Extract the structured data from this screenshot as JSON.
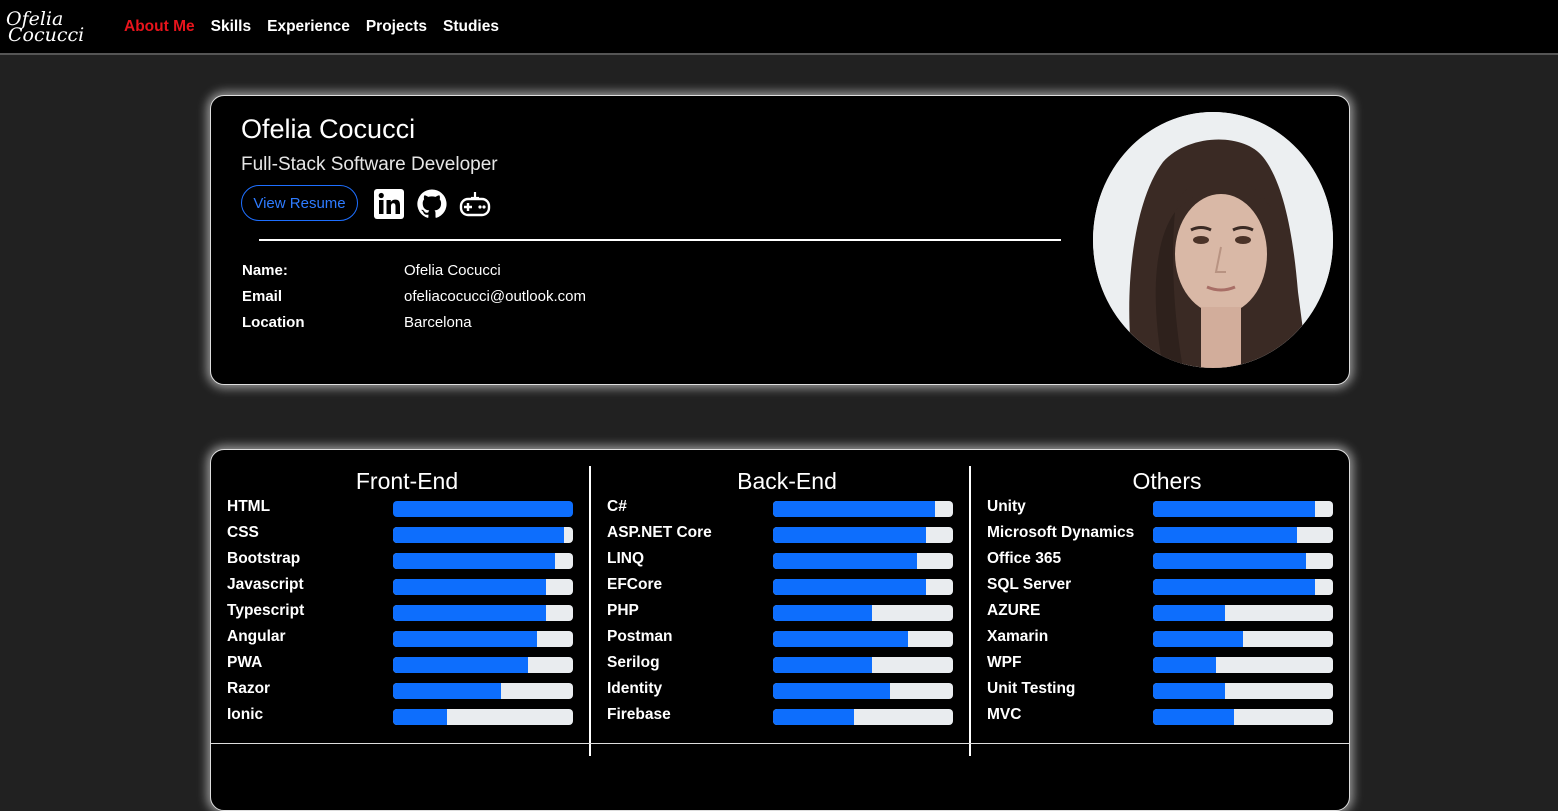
{
  "nav": {
    "logo_line1": "Ofelia",
    "logo_line2": "Cocucci",
    "links": [
      "About Me",
      "Skills",
      "Experience",
      "Projects",
      "Studies"
    ]
  },
  "profile": {
    "name": "Ofelia Cocucci",
    "title": "Full-Stack Software Developer",
    "resume_label": "View Resume",
    "info": [
      {
        "label": "Name:",
        "value": "Ofelia Cocucci"
      },
      {
        "label": "Email",
        "value": "ofeliacocucci@outlook.com"
      },
      {
        "label": "Location",
        "value": "Barcelona"
      }
    ],
    "social_icons": [
      "linkedin-icon",
      "github-icon",
      "gamepad-icon"
    ]
  },
  "skills": {
    "frontend": {
      "title": "Front-End",
      "items": [
        {
          "label": "HTML",
          "level": 1.0
        },
        {
          "label": "CSS",
          "level": 0.95
        },
        {
          "label": "Bootstrap",
          "level": 0.9
        },
        {
          "label": "Javascript",
          "level": 0.85
        },
        {
          "label": "Typescript",
          "level": 0.85
        },
        {
          "label": "Angular",
          "level": 0.8
        },
        {
          "label": "PWA",
          "level": 0.75
        },
        {
          "label": "Razor",
          "level": 0.6
        },
        {
          "label": "Ionic",
          "level": 0.3
        }
      ]
    },
    "backend": {
      "title": "Back-End",
      "items": [
        {
          "label": "C#",
          "level": 0.9
        },
        {
          "label": "ASP.NET Core",
          "level": 0.85
        },
        {
          "label": "LINQ",
          "level": 0.8
        },
        {
          "label": "EFCore",
          "level": 0.85
        },
        {
          "label": "PHP",
          "level": 0.55
        },
        {
          "label": "Postman",
          "level": 0.75
        },
        {
          "label": "Serilog",
          "level": 0.55
        },
        {
          "label": "Identity",
          "level": 0.65
        },
        {
          "label": "Firebase",
          "level": 0.45
        }
      ]
    },
    "others": {
      "title": "Others",
      "items": [
        {
          "label": "Unity",
          "level": 0.9
        },
        {
          "label": "Microsoft Dynamics",
          "level": 0.8
        },
        {
          "label": "Office 365",
          "level": 0.85
        },
        {
          "label": "SQL Server",
          "level": 0.9
        },
        {
          "label": "AZURE",
          "level": 0.4
        },
        {
          "label": "Xamarin",
          "level": 0.5
        },
        {
          "label": "WPF",
          "level": 0.35
        },
        {
          "label": "Unit Testing",
          "level": 0.4
        },
        {
          "label": "MVC",
          "level": 0.45
        }
      ]
    }
  },
  "colors": {
    "accent_active": "#e8141c",
    "bar_fill": "#0d6efd",
    "bar_track": "#e9ecef"
  }
}
